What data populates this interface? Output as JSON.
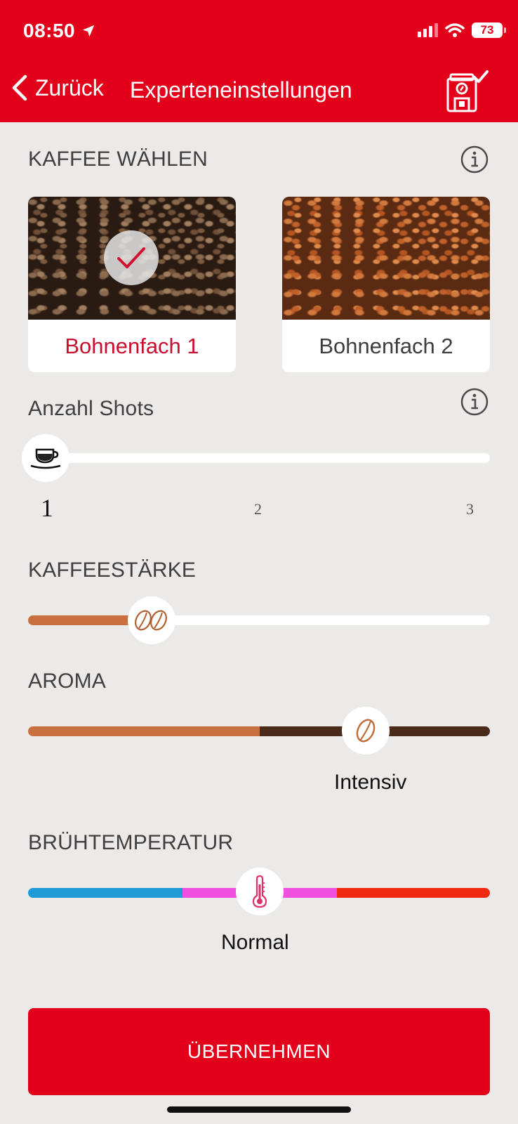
{
  "status_bar": {
    "time": "08:50",
    "battery": "73"
  },
  "nav": {
    "back_label": "Zurück",
    "title": "Experteneinstellungen"
  },
  "coffee_select": {
    "label": "KAFFEE WÄHLEN",
    "options": [
      {
        "label": "Bohnenfach 1",
        "selected": true
      },
      {
        "label": "Bohnenfach 2",
        "selected": false
      }
    ]
  },
  "shots": {
    "label": "Anzahl Shots",
    "ticks": [
      "1",
      "2",
      "3"
    ],
    "value": 1
  },
  "strength": {
    "label": "KAFFEESTÄRKE",
    "level_fraction": 0.27
  },
  "aroma": {
    "label": "AROMA",
    "value_text": "Intensiv",
    "level_fraction": 0.73
  },
  "temperature": {
    "label": "BRÜHTEMPERATUR",
    "value_text": "Normal",
    "level_fraction": 0.5
  },
  "apply_button": {
    "label": "ÜBERNEHMEN"
  },
  "colors": {
    "brand_red": "#e2001a",
    "selected_text": "#c8102e",
    "coffee_light": "#c87040",
    "coffee_dark": "#4a2a18",
    "temp_cold": "#1e9bd7",
    "temp_normal": "#f050e0",
    "temp_hot": "#f02a10"
  }
}
